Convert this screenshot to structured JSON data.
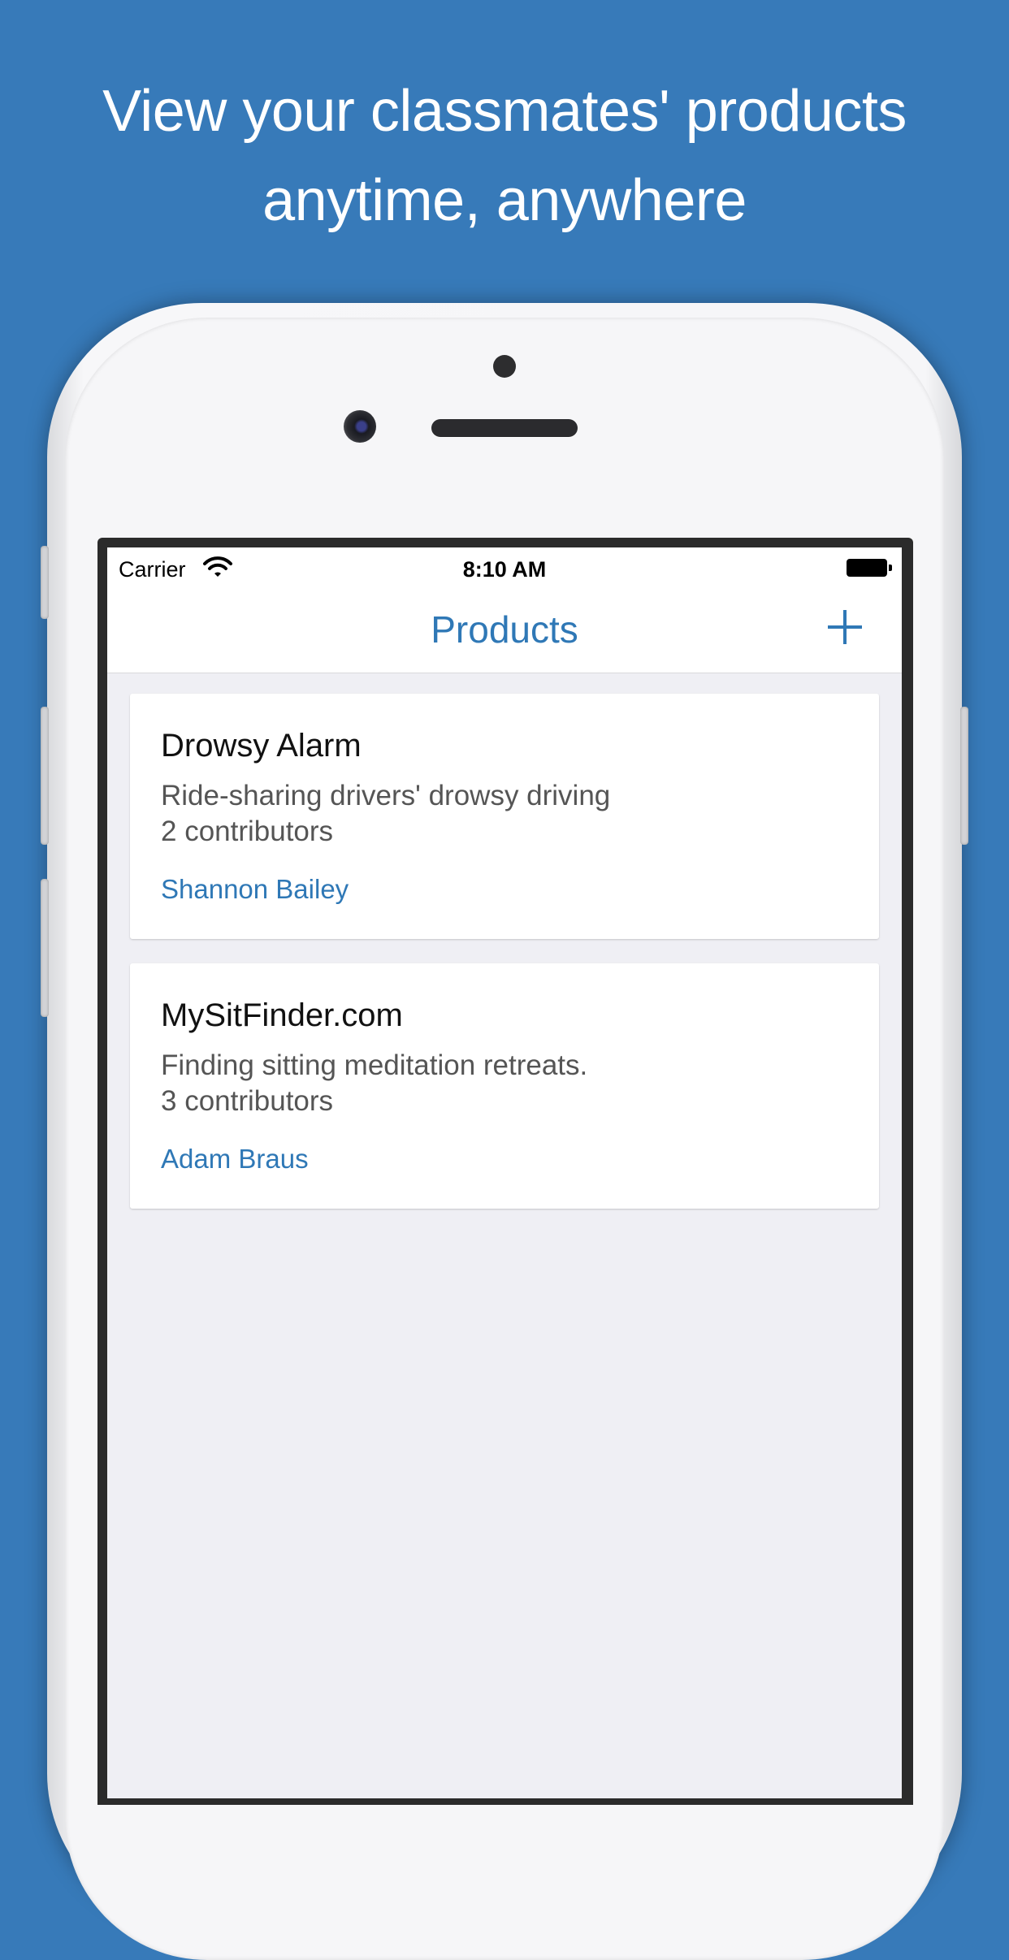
{
  "headline": {
    "line1": "View your classmates' products",
    "line2": "anytime, anywhere"
  },
  "status_bar": {
    "carrier": "Carrier",
    "time": "8:10 AM",
    "icons": [
      "wifi-icon",
      "battery-icon"
    ]
  },
  "nav": {
    "title": "Products",
    "add_icon": "plus-icon"
  },
  "products": [
    {
      "title": "Drowsy Alarm",
      "description": "Ride-sharing drivers' drowsy driving",
      "contributors": "2 contributors",
      "author": "Shannon Bailey"
    },
    {
      "title": "MySitFinder.com",
      "description": "Finding sitting meditation retreats.",
      "contributors": "3 contributors",
      "author": "Adam Braus"
    }
  ],
  "colors": {
    "background": "#377ab9",
    "accent": "#2f78b6",
    "list_background": "#efeff4"
  }
}
